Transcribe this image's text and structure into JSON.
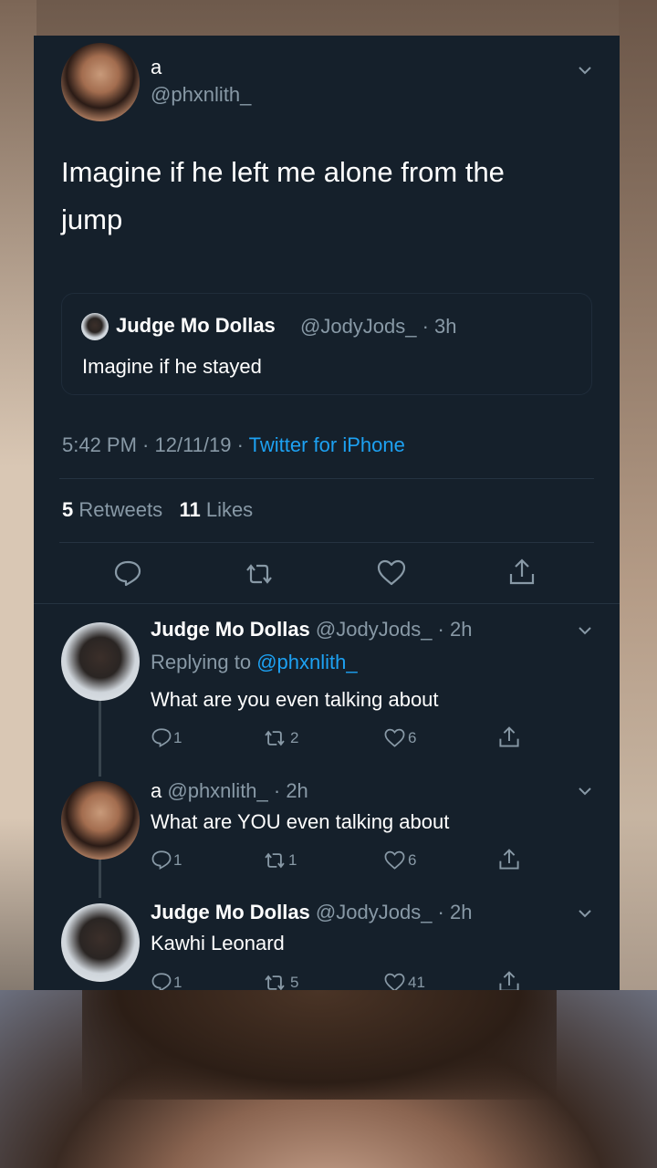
{
  "tweet": {
    "name": "a",
    "handle": "@phxnlith_",
    "text_line1": "Imagine if he left me alone from the",
    "text_line2": "jump",
    "quote": {
      "name": "Judge Mo Dollas",
      "meta": "@JodyJods_ · 3h",
      "text": "Imagine if he stayed"
    },
    "timestamp": "5:42 PM · 12/11/19 · ",
    "source": "Twitter for iPhone",
    "retweets_count": "5",
    "retweets_label": "Retweets",
    "likes_count": "11",
    "likes_label": "Likes"
  },
  "replies": [
    {
      "name": "Judge Mo Dollas",
      "meta": "@JodyJods_ · 2h",
      "replying_prefix": "Replying to ",
      "replying_handle": "@phxnlith_",
      "text": "What are you even talking about",
      "comments": "1",
      "retweets": "2",
      "likes": "6"
    },
    {
      "name": "a",
      "meta": "@phxnlith_ · 2h",
      "text": "What are YOU even talking about",
      "comments": "1",
      "retweets": "1",
      "likes": "6"
    },
    {
      "name": "Judge Mo Dollas",
      "meta": "@JodyJods_ · 2h",
      "text": "Kawhi Leonard",
      "comments": "1",
      "retweets": "5",
      "likes": "41"
    }
  ],
  "icons": {
    "chevron": "chevron-down-icon",
    "comment": "comment-icon",
    "retweet": "retweet-icon",
    "like": "heart-icon",
    "share": "share-icon"
  },
  "colors": {
    "background": "#15202b",
    "link": "#1da1f2",
    "muted": "#8899a6"
  }
}
